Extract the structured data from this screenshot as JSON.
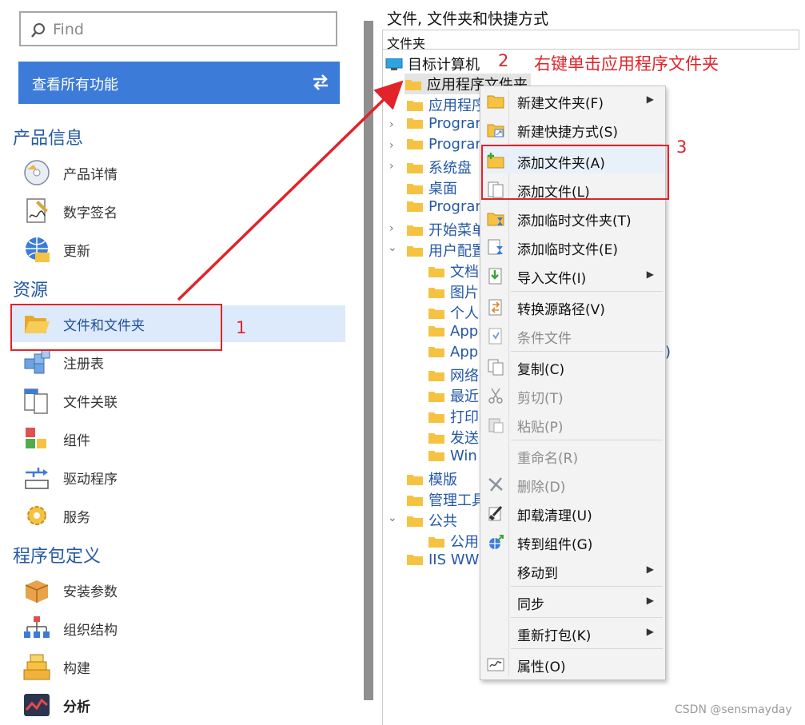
{
  "search": {
    "placeholder": "Find",
    "icon": "search-icon"
  },
  "all_features_button": {
    "label": "查看所有功能",
    "icon": "swap-arrows-icon"
  },
  "sections": {
    "product_info": "产品信息",
    "resources": "资源",
    "package_definition": "程序包定义"
  },
  "nav": {
    "product_details": "产品详情",
    "digital_signature": "数字签名",
    "update": "更新",
    "files_and_folders": "文件和文件夹",
    "registry": "注册表",
    "file_association": "文件关联",
    "components": "组件",
    "drivers": "驱动程序",
    "services": "服务",
    "install_params": "安装参数",
    "org_structure": "组织结构",
    "build": "构建",
    "analysis": "分析"
  },
  "right": {
    "title": "文件, 文件夹和快捷方式",
    "column_header": "文件夹",
    "tree": {
      "target_computer": "目标计算机",
      "app_folder": "应用程序文件夹",
      "rows": [
        "应用程序",
        "Program",
        "Program",
        "系统盘",
        "桌面",
        "Program",
        "开始菜单",
        "用户配置"
      ],
      "user_children": [
        "文档",
        "图片",
        "个人",
        "App",
        "App",
        "网络",
        "最近",
        "打印",
        "发送",
        "Win"
      ],
      "rows2": [
        "模版",
        "管理工具",
        "公共"
      ],
      "public_child": "公用",
      "iis": "IIS WW",
      "partial_text": ")"
    }
  },
  "annotations": {
    "step1": "1",
    "step2": "2",
    "step2_text": "右键单击应用程序文件夹",
    "step3": "3"
  },
  "menu": {
    "new_folder": "新建文件夹(F)",
    "new_shortcut": "新建快捷方式(S)",
    "add_folder": "添加文件夹(A)",
    "add_file": "添加文件(L)",
    "add_temp_folder": "添加临时文件夹(T)",
    "add_temp_file": "添加临时文件(E)",
    "import_file": "导入文件(I)",
    "convert_source": "转换源路径(V)",
    "conditional_file": "条件文件",
    "copy": "复制(C)",
    "cut": "剪切(T)",
    "paste": "粘贴(P)",
    "rename": "重命名(R)",
    "delete": "删除(D)",
    "uninstall_cleanup": "卸载清理(U)",
    "to_component": "转到组件(G)",
    "move_to": "移动到",
    "sync": "同步",
    "repackage": "重新打包(K)",
    "properties": "属性(O)"
  },
  "watermark": "CSDN @sensmayday",
  "colors": {
    "accent": "#3d7bd9",
    "annotation": "#e0242a",
    "folder": "#f5c341",
    "link": "#2458a6"
  }
}
